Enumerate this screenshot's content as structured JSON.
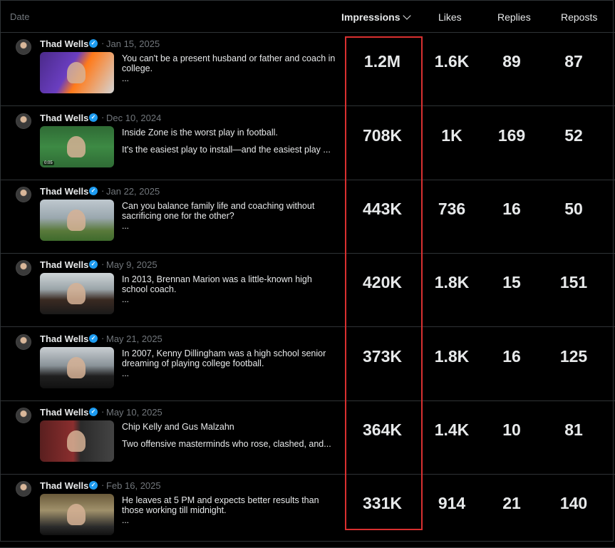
{
  "columns": {
    "date": "Date",
    "impressions": "Impressions",
    "likes": "Likes",
    "replies": "Replies",
    "reposts": "Reposts"
  },
  "accent_color": "#1d9bf0",
  "highlight_color": "#d93030",
  "rows": [
    {
      "name": "Thad Wells",
      "date": "Jan 15, 2025",
      "text_line1": "You can't be a present husband or father and coach in college.",
      "text_line2": "",
      "ellipsis": "...",
      "thumb_caption": "",
      "impressions": "1.2M",
      "likes": "1.6K",
      "replies": "89",
      "reposts": "87"
    },
    {
      "name": "Thad Wells",
      "date": "Dec 10, 2024",
      "text_line1": "Inside Zone is the worst play in football.",
      "text_line2": "It's the easiest play to install—and the easiest play ...",
      "ellipsis": "",
      "thumb_caption": "0:05",
      "impressions": "708K",
      "likes": "1K",
      "replies": "169",
      "reposts": "52"
    },
    {
      "name": "Thad Wells",
      "date": "Jan 22, 2025",
      "text_line1": "Can you balance family life and coaching without sacrificing one for the other?",
      "text_line2": "",
      "ellipsis": "...",
      "thumb_caption": "",
      "impressions": "443K",
      "likes": "736",
      "replies": "16",
      "reposts": "50"
    },
    {
      "name": "Thad Wells",
      "date": "May 9, 2025",
      "text_line1": "In 2013, Brennan Marion was a little-known high school coach.",
      "text_line2": "",
      "ellipsis": "...",
      "thumb_caption": "",
      "impressions": "420K",
      "likes": "1.8K",
      "replies": "15",
      "reposts": "151"
    },
    {
      "name": "Thad Wells",
      "date": "May 21, 2025",
      "text_line1": "In 2007, Kenny Dillingham was a high school senior dreaming of playing college football.",
      "text_line2": "",
      "ellipsis": "...",
      "thumb_caption": "",
      "impressions": "373K",
      "likes": "1.8K",
      "replies": "16",
      "reposts": "125"
    },
    {
      "name": "Thad Wells",
      "date": "May 10, 2025",
      "text_line1": "Chip Kelly and Gus Malzahn",
      "text_line2": "Two offensive masterminds who rose, clashed, and...",
      "ellipsis": "",
      "thumb_caption": "",
      "impressions": "364K",
      "likes": "1.4K",
      "replies": "10",
      "reposts": "81"
    },
    {
      "name": "Thad Wells",
      "date": "Feb 16, 2025",
      "text_line1": "He leaves at 5 PM and expects better results than those working till midnight.",
      "text_line2": "",
      "ellipsis": "...",
      "thumb_caption": "",
      "impressions": "331K",
      "likes": "914",
      "replies": "21",
      "reposts": "140"
    }
  ]
}
